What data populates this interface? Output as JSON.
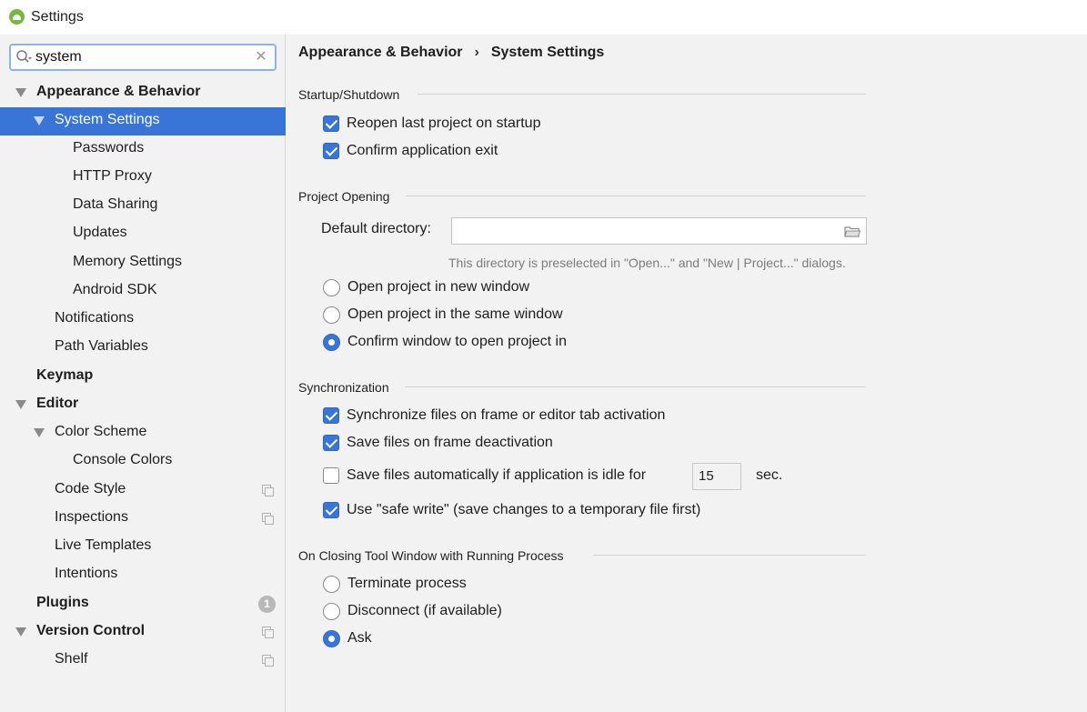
{
  "window": {
    "title": "Settings"
  },
  "search": {
    "value": "system",
    "clear": "✕"
  },
  "sidebar": {
    "items": [
      {
        "label": "Appearance & Behavior"
      },
      {
        "label": "System Settings"
      },
      {
        "label": "Passwords"
      },
      {
        "label": "HTTP Proxy"
      },
      {
        "label": "Data Sharing"
      },
      {
        "label": "Updates"
      },
      {
        "label": "Memory Settings"
      },
      {
        "label": "Android SDK"
      },
      {
        "label": "Notifications"
      },
      {
        "label": "Path Variables"
      },
      {
        "label": "Keymap"
      },
      {
        "label": "Editor"
      },
      {
        "label": "Color Scheme"
      },
      {
        "label": "Console Colors"
      },
      {
        "label": "Code Style"
      },
      {
        "label": "Inspections"
      },
      {
        "label": "Live Templates"
      },
      {
        "label": "Intentions"
      },
      {
        "label": "Plugins",
        "badge": "1"
      },
      {
        "label": "Version Control"
      },
      {
        "label": "Shelf"
      }
    ]
  },
  "breadcrumb": {
    "parent": "Appearance & Behavior",
    "separator": "›",
    "current": "System Settings"
  },
  "startup": {
    "title": "Startup/Shutdown",
    "reopen": {
      "label": "Reopen last project on startup",
      "checked": true
    },
    "confirm_exit": {
      "label": "Confirm application exit",
      "checked": true
    }
  },
  "project_opening": {
    "title": "Project Opening",
    "default_dir_label": "Default directory:",
    "default_dir_value": "",
    "hint": "This directory is preselected in \"Open...\" and \"New | Project...\" dialogs.",
    "options": [
      {
        "label": "Open project in new window",
        "selected": false
      },
      {
        "label": "Open project in the same window",
        "selected": false
      },
      {
        "label": "Confirm window to open project in",
        "selected": true
      }
    ]
  },
  "sync": {
    "title": "Synchronization",
    "sync_files": {
      "label": "Synchronize files on frame or editor tab activation",
      "checked": true
    },
    "save_deactivation": {
      "label": "Save files on frame deactivation",
      "checked": true
    },
    "save_idle": {
      "label": "Save files automatically if application is idle for",
      "checked": false,
      "value": "15",
      "unit": "sec."
    },
    "safe_write": {
      "label": "Use \"safe write\" (save changes to a temporary file first)",
      "checked": true
    }
  },
  "closing": {
    "title": "On Closing Tool Window with Running Process",
    "options": [
      {
        "label": "Terminate process",
        "selected": false
      },
      {
        "label": "Disconnect (if available)",
        "selected": false
      },
      {
        "label": "Ask",
        "selected": true
      }
    ]
  },
  "colors": {
    "accent": "#3875d6",
    "background": "#f2f2f2"
  }
}
